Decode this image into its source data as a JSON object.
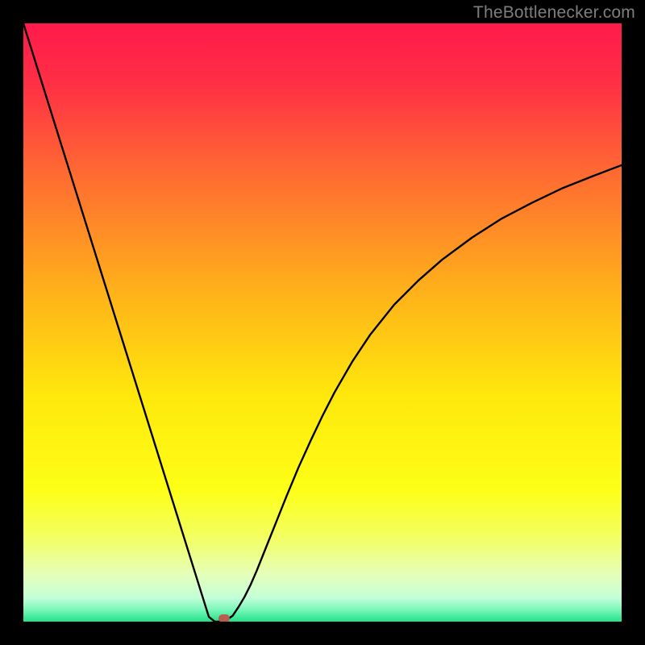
{
  "watermark": {
    "text": "TheBottlenecker.com"
  },
  "chart_data": {
    "type": "line",
    "title": "",
    "xlabel": "",
    "ylabel": "",
    "xlim": [
      0,
      100
    ],
    "ylim": [
      0,
      100
    ],
    "gradient_stops": [
      {
        "pct": 0,
        "color": "#ff1a4b"
      },
      {
        "pct": 10,
        "color": "#ff2f45"
      },
      {
        "pct": 25,
        "color": "#ff6a32"
      },
      {
        "pct": 45,
        "color": "#ffb21a"
      },
      {
        "pct": 62,
        "color": "#ffe70c"
      },
      {
        "pct": 78,
        "color": "#fdff16"
      },
      {
        "pct": 86,
        "color": "#f3ff63"
      },
      {
        "pct": 92,
        "color": "#e5ffb8"
      },
      {
        "pct": 96,
        "color": "#c4ffd8"
      },
      {
        "pct": 98,
        "color": "#7bf7ba"
      },
      {
        "pct": 100,
        "color": "#21e08a"
      }
    ],
    "series": [
      {
        "name": "bottleneck-curve",
        "x": [
          0,
          2,
          4,
          6,
          8,
          10,
          12,
          14,
          16,
          18,
          20,
          22,
          24,
          26,
          28,
          30,
          31,
          32,
          33,
          34,
          35,
          36,
          37,
          38,
          39,
          40,
          42,
          44,
          46,
          48,
          50,
          52,
          55,
          58,
          62,
          66,
          70,
          75,
          80,
          85,
          90,
          95,
          100
        ],
        "y": [
          100,
          93.6,
          87.2,
          80.8,
          74.4,
          68,
          61.6,
          55.2,
          48.8,
          42.4,
          36,
          29.6,
          23.2,
          16.8,
          10.4,
          4,
          0.8,
          0,
          0,
          0.3,
          1,
          2.5,
          4.2,
          6.2,
          8.5,
          11,
          16,
          21,
          25.8,
          30.2,
          34.4,
          38.3,
          43.5,
          48,
          53,
          57,
          60.5,
          64.2,
          67.4,
          70,
          72.4,
          74.4,
          76.3
        ]
      }
    ],
    "marker": {
      "x": 33.5,
      "y": 0.5,
      "color": "#bb5a4f"
    }
  }
}
